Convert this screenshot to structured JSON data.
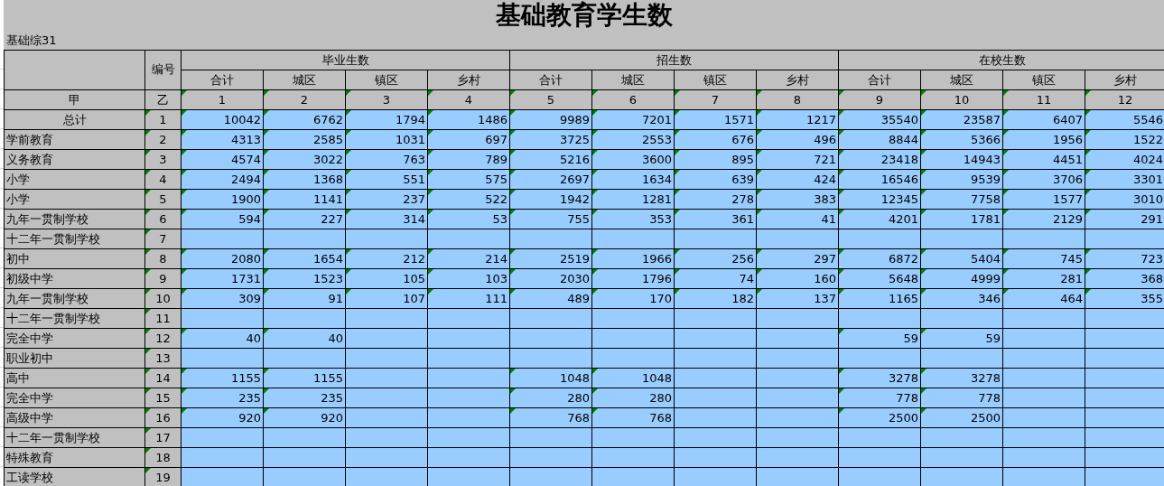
{
  "title": "基础教育学生数",
  "table_code": "基础综31",
  "header": {
    "code_label": "编号",
    "groups": [
      {
        "label": "毕业生数",
        "columns": [
          "合计",
          "城区",
          "镇区",
          "乡村"
        ]
      },
      {
        "label": "招生数",
        "columns": [
          "合计",
          "城区",
          "镇区",
          "乡村"
        ]
      },
      {
        "label": "在校生数",
        "columns": [
          "合计",
          "城区",
          "镇区",
          "乡村"
        ]
      }
    ],
    "index_row": {
      "label": "甲",
      "code": "乙",
      "numbers": [
        "1",
        "2",
        "3",
        "4",
        "5",
        "6",
        "7",
        "8",
        "9",
        "10",
        "11",
        "12"
      ]
    }
  },
  "rows": [
    {
      "kind": "total",
      "label": "总计",
      "code": "1",
      "values": {
        "1": "10042",
        "2": "6762",
        "3": "1794",
        "4": "1486",
        "5": "9989",
        "6": "7201",
        "7": "1571",
        "8": "1217",
        "9": "35540",
        "10": "23587",
        "11": "6407",
        "12": "5546"
      }
    },
    {
      "kind": "item",
      "label": "学前教育",
      "code": "2",
      "values": {
        "1": "4313",
        "2": "2585",
        "3": "1031",
        "4": "697",
        "5": "3725",
        "6": "2553",
        "7": "676",
        "8": "496",
        "9": "8844",
        "10": "5366",
        "11": "1956",
        "12": "1522"
      }
    },
    {
      "kind": "item",
      "label": "义务教育",
      "code": "3",
      "values": {
        "1": "4574",
        "2": "3022",
        "3": "763",
        "4": "789",
        "5": "5216",
        "6": "3600",
        "7": "895",
        "8": "721",
        "9": "23418",
        "10": "14943",
        "11": "4451",
        "12": "4024"
      }
    },
    {
      "kind": "item",
      "label": "小学",
      "code": "4",
      "values": {
        "1": "2494",
        "2": "1368",
        "3": "551",
        "4": "575",
        "5": "2697",
        "6": "1634",
        "7": "639",
        "8": "424",
        "9": "16546",
        "10": "9539",
        "11": "3706",
        "12": "3301"
      }
    },
    {
      "kind": "item",
      "label": "小学",
      "code": "5",
      "values": {
        "1": "1900",
        "2": "1141",
        "3": "237",
        "4": "522",
        "5": "1942",
        "6": "1281",
        "7": "278",
        "8": "383",
        "9": "12345",
        "10": "7758",
        "11": "1577",
        "12": "3010"
      }
    },
    {
      "kind": "item",
      "label": "九年一贯制学校",
      "code": "6",
      "values": {
        "1": "594",
        "2": "227",
        "3": "314",
        "4": "53",
        "5": "755",
        "6": "353",
        "7": "361",
        "8": "41",
        "9": "4201",
        "10": "1781",
        "11": "2129",
        "12": "291"
      }
    },
    {
      "kind": "item",
      "label": "十二年一贯制学校",
      "code": "7"
    },
    {
      "kind": "item",
      "label": "初中",
      "code": "8",
      "values": {
        "1": "2080",
        "2": "1654",
        "3": "212",
        "4": "214",
        "5": "2519",
        "6": "1966",
        "7": "256",
        "8": "297",
        "9": "6872",
        "10": "5404",
        "11": "745",
        "12": "723"
      }
    },
    {
      "kind": "item",
      "label": "初级中学",
      "code": "9",
      "values": {
        "1": "1731",
        "2": "1523",
        "3": "105",
        "4": "103",
        "5": "2030",
        "6": "1796",
        "7": "74",
        "8": "160",
        "9": "5648",
        "10": "4999",
        "11": "281",
        "12": "368"
      }
    },
    {
      "kind": "item",
      "label": "九年一贯制学校",
      "code": "10",
      "values": {
        "1": "309",
        "2": "91",
        "3": "107",
        "4": "111",
        "5": "489",
        "6": "170",
        "7": "182",
        "8": "137",
        "9": "1165",
        "10": "346",
        "11": "464",
        "12": "355"
      }
    },
    {
      "kind": "item",
      "label": "十二年一贯制学校",
      "code": "11"
    },
    {
      "kind": "item",
      "label": "完全中学",
      "code": "12",
      "values": {
        "1": "40",
        "2": "40",
        "9": "59",
        "10": "59"
      }
    },
    {
      "kind": "item",
      "label": "职业初中",
      "code": "13"
    },
    {
      "kind": "item",
      "label": "高中",
      "code": "14",
      "values": {
        "1": "1155",
        "2": "1155",
        "5": "1048",
        "6": "1048",
        "9": "3278",
        "10": "3278"
      }
    },
    {
      "kind": "item",
      "label": "完全中学",
      "code": "15",
      "values": {
        "1": "235",
        "2": "235",
        "5": "280",
        "6": "280",
        "9": "778",
        "10": "778"
      }
    },
    {
      "kind": "item",
      "label": "高级中学",
      "code": "16",
      "values": {
        "1": "920",
        "2": "920",
        "5": "768",
        "6": "768",
        "9": "2500",
        "10": "2500"
      }
    },
    {
      "kind": "item",
      "label": "十二年一贯制学校",
      "code": "17"
    },
    {
      "kind": "item",
      "label": "特殊教育",
      "code": "18"
    },
    {
      "kind": "item",
      "label": "工读学校",
      "code": "19"
    }
  ]
}
